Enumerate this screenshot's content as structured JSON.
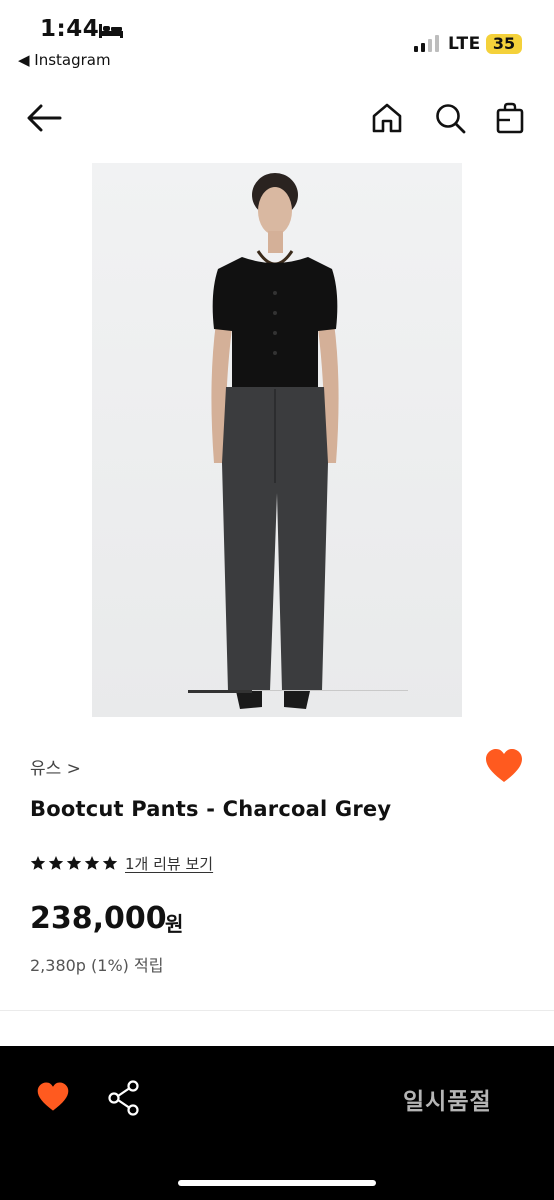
{
  "status_bar": {
    "time": "1:44",
    "back_app": "◀ Instagram",
    "network": "LTE",
    "battery": "35"
  },
  "product": {
    "brand": "유스 >",
    "title": "Bootcut Pants - Charcoal Grey",
    "rating_stars": 5,
    "review_link": "1개 리뷰 보기",
    "price": "238,000",
    "currency": "원",
    "points": "2,380p (1%) 적립"
  },
  "bottom_bar": {
    "status_button": "일시품절"
  },
  "colors": {
    "accent": "#ff5a1f",
    "bottom_bar_bg": "#000000",
    "battery": "#f4d13a"
  },
  "icons": [
    "bed-icon",
    "signal-icon",
    "back-arrow-icon",
    "home-icon",
    "search-icon",
    "shopping-bag-icon",
    "heart-icon",
    "star-icon",
    "share-icon"
  ]
}
